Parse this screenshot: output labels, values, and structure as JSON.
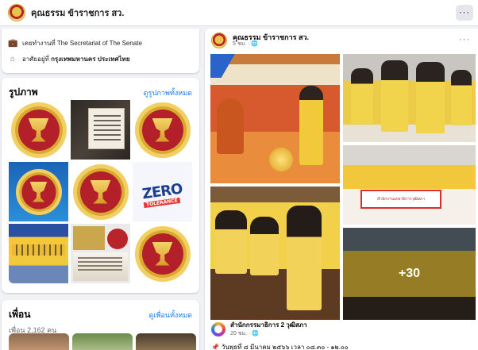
{
  "header": {
    "page_name": "คุณธรรม ข้าราชการ สว.",
    "more_label": "···"
  },
  "intro": {
    "workplace": "เคยทำงานที่ The Secretariat of The Senate",
    "location_prefix": "อาศัยอยู่ที่",
    "location": "กรุงเทพมหานคร ประเทศไทย"
  },
  "photos": {
    "title": "รูปภาพ",
    "see_all": "ดูรูปภาพทั้งหมด",
    "tiles": [
      "emblem",
      "document",
      "emblem",
      "emblem-blue",
      "emblem",
      "zero-tolerance",
      "group-photo",
      "collage",
      "emblem"
    ],
    "zero_label": "ZERO",
    "zero_sub": "TOLERANCE"
  },
  "friends": {
    "title": "เพื่อน",
    "see_all": "ดูเพื่อนทั้งหมด",
    "count": "เพื่อน 2,162 คน"
  },
  "post": {
    "author": "คุณธรรม ข้าราชการ สว.",
    "time": "5 ชม. · 🌐",
    "more_label": "···",
    "extra_photos": "+30",
    "banner_text": "สำนักงานเลขาธิการวุฒิสภา",
    "shared_author": "สำนักกรรมาธิการ 2 วุฒิสภา",
    "shared_time": "20 ชม. · 🌐",
    "shared_text": "วันพุธที่ ๘ มีนาคม ๒๕๖๖ เวลา ๐๘.๓๐ - ๑๒.๐๐"
  }
}
